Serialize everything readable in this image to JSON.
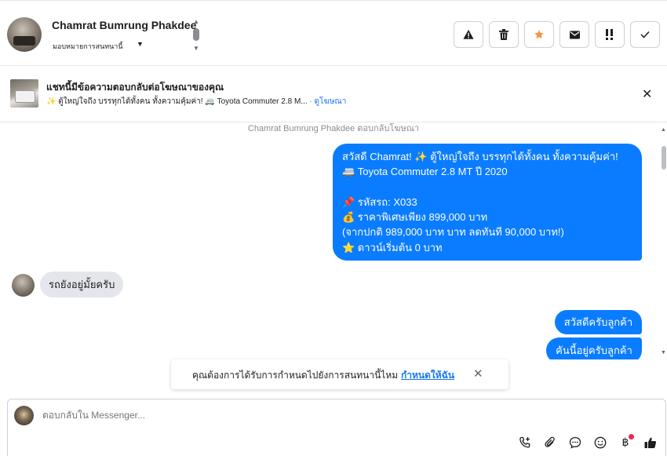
{
  "header": {
    "contact_name": "Chamrat Bumrung Phakdee",
    "assign_label": "มอบหมายการสนทนานี้",
    "actions": [
      {
        "name": "report-spam-button",
        "icon": "warning-icon"
      },
      {
        "name": "delete-button",
        "icon": "trash-icon"
      },
      {
        "name": "star-button",
        "icon": "star-icon"
      },
      {
        "name": "mark-unread-button",
        "icon": "envelope-icon"
      },
      {
        "name": "follow-up-button",
        "icon": "exclamation-icon"
      },
      {
        "name": "mark-done-button",
        "icon": "check-icon"
      }
    ],
    "accent_star": "#f7923b"
  },
  "ad_banner": {
    "title": "แชทนี้มีข้อความตอบกลับต่อโฆษณาของคุณ",
    "preview": "✨ ตู้ใหญ่ใจถึง บรรทุกได้ทั้งคน ทั้งความคุ้มค่า! 🚐 Toyota Commuter 2.8 M...",
    "separator": "·",
    "link": "ดูโฆษณา"
  },
  "chat": {
    "system_note": "Chamrat Bumrung Phakdee ตอบกลับโฆษณา",
    "messages": [
      {
        "direction": "out",
        "text": "สวัสดี Chamrat! ✨ ตู้ใหญ่ใจถึง บรรทุกได้ทั้งคน ทั้งความคุ้มค่า!\n🚐 Toyota Commuter 2.8 MT ปี 2020\n\n📌 รหัสรถ: X033\n💰 ราคาพิเศษเพียง 899,000 บาท\n(จากปกติ 989,000 บาท บาท ลดทันที 90,000 บาท!)\n⭐ ดาวน์เริ่มต้น 0 บาท"
      },
      {
        "direction": "in",
        "text": "รถยังอยู่มั้ยครับ"
      },
      {
        "direction": "out",
        "text": "สวัสดีครับลูกค้า"
      },
      {
        "direction": "out",
        "text": "คันนี้อยู่ครับลูกค้า"
      }
    ],
    "bubble_color": "#0a7cff",
    "incoming_color": "#e4e6eb"
  },
  "toast": {
    "text": "คุณต้องการได้รับการกำหนดไปยังการสนทนานี้ไหม",
    "link": "กำหนดให้ฉัน"
  },
  "composer": {
    "placeholder": "ตอบกลับใน Messenger...",
    "tools": [
      "call-add-icon",
      "attachment-icon",
      "chat-bubble-icon",
      "emoji-icon",
      "payment-icon",
      "thumbs-up-icon"
    ]
  }
}
